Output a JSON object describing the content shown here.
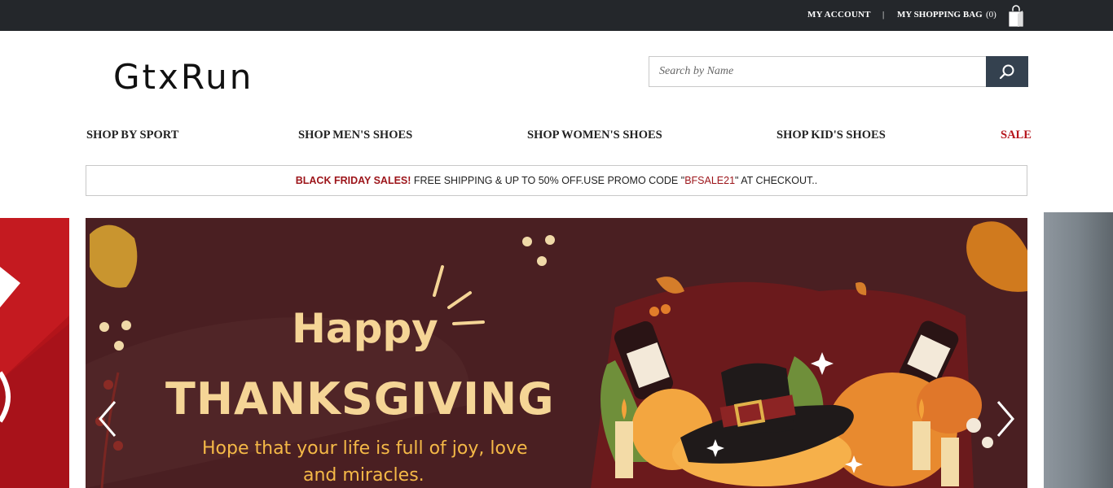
{
  "topbar": {
    "account_label": "MY ACCOUNT",
    "separator": "|",
    "bag_label": "MY SHOPPING BAG",
    "bag_count": "(0)"
  },
  "brand": {
    "logo": "GtxRun"
  },
  "search": {
    "placeholder": "Search by Name",
    "value": ""
  },
  "nav": {
    "items": [
      {
        "label": "SHOP BY SPORT"
      },
      {
        "label": "SHOP MEN'S SHOES"
      },
      {
        "label": "SHOP WOMEN'S SHOES"
      },
      {
        "label": "SHOP KID'S SHOES"
      },
      {
        "label": "SALE"
      }
    ]
  },
  "promo": {
    "headline": "BLACK FRIDAY SALES!",
    "text_before_code": " FREE SHIPPING & UP TO 50% OFF.USE PROMO CODE \"",
    "code": "BFSALE21",
    "text_after_code": "\" AT CHECKOUT.."
  },
  "banner": {
    "line1": "Happy",
    "line2": "THANKSGIVING",
    "line3": "Hope that your life is full of joy, love",
    "line4": "and miracles."
  },
  "colors": {
    "topbar_bg": "#24272b",
    "search_button": "#34414f",
    "sale_red": "#b5141b",
    "banner_bg": "#4a1f22",
    "banner_text": "#f5d596"
  },
  "icons": {
    "bag": "shopping-bag-icon",
    "search": "search-icon",
    "prev": "chevron-left-icon",
    "next": "chevron-right-icon"
  }
}
